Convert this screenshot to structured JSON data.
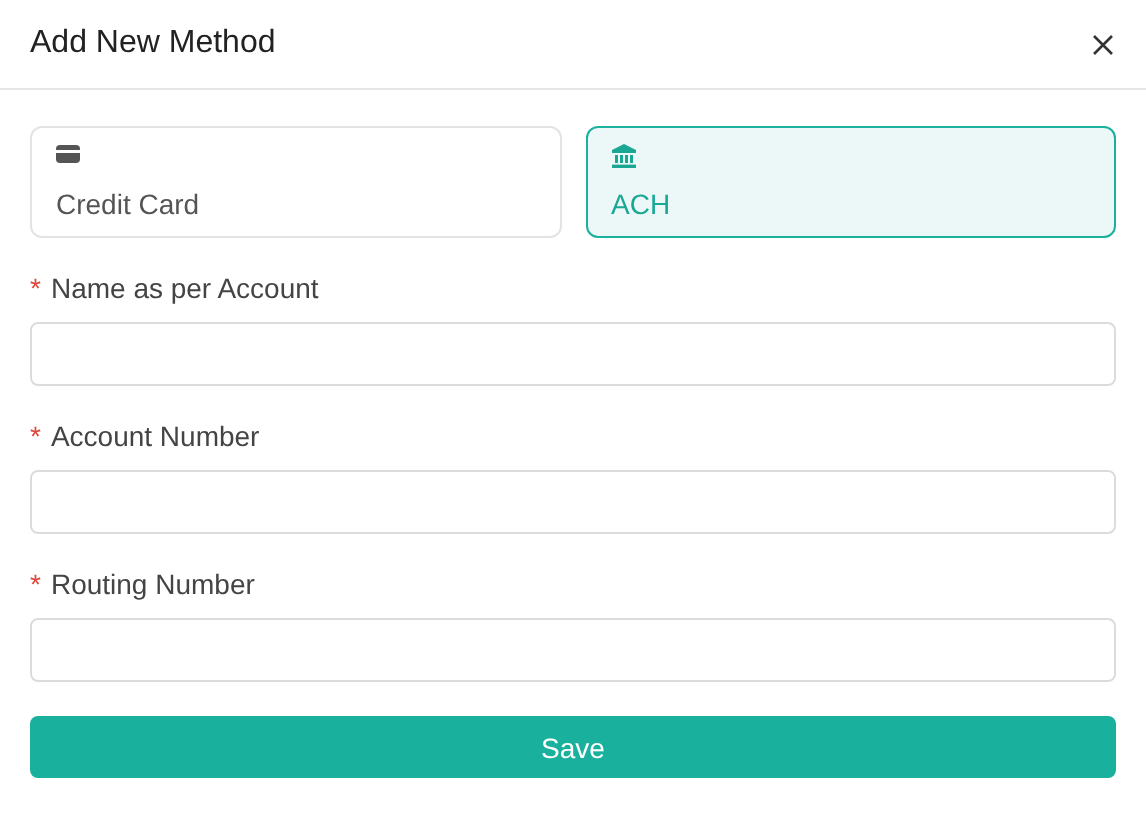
{
  "dialog": {
    "title": "Add New Method"
  },
  "methods": [
    {
      "kind": "card",
      "label": "Credit Card",
      "selected": false
    },
    {
      "kind": "bank",
      "label": "ACH",
      "selected": true
    }
  ],
  "fields": [
    {
      "label": "Name as per Account",
      "required_mark": "*"
    },
    {
      "label": "Account Number",
      "required_mark": "*"
    },
    {
      "label": "Routing Number",
      "required_mark": "*"
    }
  ],
  "submit": "Save"
}
